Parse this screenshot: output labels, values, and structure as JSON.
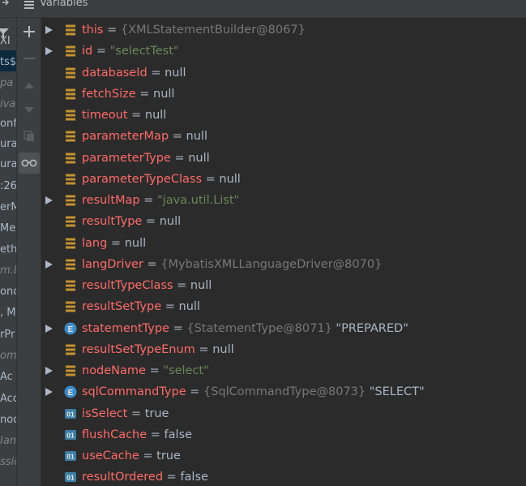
{
  "header": {
    "title": "Variables"
  },
  "left_fragments": [
    {
      "text": "XI",
      "style": "sel-text"
    },
    {
      "text": "ts$",
      "style": ""
    },
    {
      "text": "pa",
      "style": "it"
    },
    {
      "text": "iva",
      "style": "it"
    },
    {
      "text": "onf",
      "style": ""
    },
    {
      "text": "ura",
      "style": ""
    },
    {
      "text": "ura",
      "style": ""
    },
    {
      "text": ":26",
      "style": ""
    },
    {
      "text": "erM",
      "style": ""
    },
    {
      "text": "Me",
      "style": ""
    },
    {
      "text": "eth",
      "style": ""
    },
    {
      "text": "m.b",
      "style": "it"
    },
    {
      "text": "onc",
      "style": ""
    },
    {
      "text": ", M",
      "style": ""
    },
    {
      "text": "rPr",
      "style": ""
    },
    {
      "text": "om",
      "style": "it"
    },
    {
      "text": "Ac",
      "style": ""
    },
    {
      "text": "Acc",
      "style": ""
    },
    {
      "text": "nod",
      "style": ""
    },
    {
      "text": "Ian",
      "style": "it"
    },
    {
      "text": "ssic",
      "style": "it"
    }
  ],
  "variables": [
    {
      "name": "this",
      "value": "{XMLStatementBuilder@8067}",
      "vtype": "ref",
      "icon": "field",
      "expandable": true
    },
    {
      "name": "id",
      "value": "\"selectTest\"",
      "vtype": "str",
      "icon": "field",
      "expandable": true
    },
    {
      "name": "databaseId",
      "value": "null",
      "vtype": "plain",
      "icon": "field",
      "expandable": false
    },
    {
      "name": "fetchSize",
      "value": "null",
      "vtype": "plain",
      "icon": "field",
      "expandable": false
    },
    {
      "name": "timeout",
      "value": "null",
      "vtype": "plain",
      "icon": "field",
      "expandable": false
    },
    {
      "name": "parameterMap",
      "value": "null",
      "vtype": "plain",
      "icon": "field",
      "expandable": false
    },
    {
      "name": "parameterType",
      "value": "null",
      "vtype": "plain",
      "icon": "field",
      "expandable": false
    },
    {
      "name": "parameterTypeClass",
      "value": "null",
      "vtype": "plain",
      "icon": "field",
      "expandable": false
    },
    {
      "name": "resultMap",
      "value": "\"java.util.List\"",
      "vtype": "str",
      "icon": "field",
      "expandable": true
    },
    {
      "name": "resultType",
      "value": "null",
      "vtype": "plain",
      "icon": "field",
      "expandable": false
    },
    {
      "name": "lang",
      "value": "null",
      "vtype": "plain",
      "icon": "field",
      "expandable": false
    },
    {
      "name": "langDriver",
      "value": "{MybatisXMLLanguageDriver@8070}",
      "vtype": "ref",
      "icon": "field",
      "expandable": true
    },
    {
      "name": "resultTypeClass",
      "value": "null",
      "vtype": "plain",
      "icon": "field",
      "expandable": false
    },
    {
      "name": "resultSetType",
      "value": "null",
      "vtype": "plain",
      "icon": "field",
      "expandable": false
    },
    {
      "name": "statementType",
      "value": "{StatementType@8071}",
      "extra": "\"PREPARED\"",
      "vtype": "ref",
      "icon": "enum",
      "expandable": true
    },
    {
      "name": "resultSetTypeEnum",
      "value": "null",
      "vtype": "plain",
      "icon": "field",
      "expandable": false
    },
    {
      "name": "nodeName",
      "value": "\"select\"",
      "vtype": "str",
      "icon": "field",
      "expandable": true
    },
    {
      "name": "sqlCommandType",
      "value": "{SqlCommandType@8073}",
      "extra": "\"SELECT\"",
      "vtype": "ref",
      "icon": "enum",
      "expandable": true
    },
    {
      "name": "isSelect",
      "value": "true",
      "vtype": "plain",
      "icon": "bool",
      "expandable": false
    },
    {
      "name": "flushCache",
      "value": "false",
      "vtype": "plain",
      "icon": "bool",
      "expandable": false
    },
    {
      "name": "useCache",
      "value": "true",
      "vtype": "plain",
      "icon": "bool",
      "expandable": false
    },
    {
      "name": "resultOrdered",
      "value": "false",
      "vtype": "plain",
      "icon": "bool",
      "expandable": false
    }
  ],
  "icon_labels": {
    "enum": "E",
    "bool": "01"
  },
  "colors": {
    "name": "#ff6b68",
    "string": "#6a8759",
    "ref": "#787878",
    "plain": "#a9b7c6",
    "field_icon": "#c4922f",
    "enum_icon": "#3d8bc9",
    "bool_icon": "#3d7ea6"
  }
}
